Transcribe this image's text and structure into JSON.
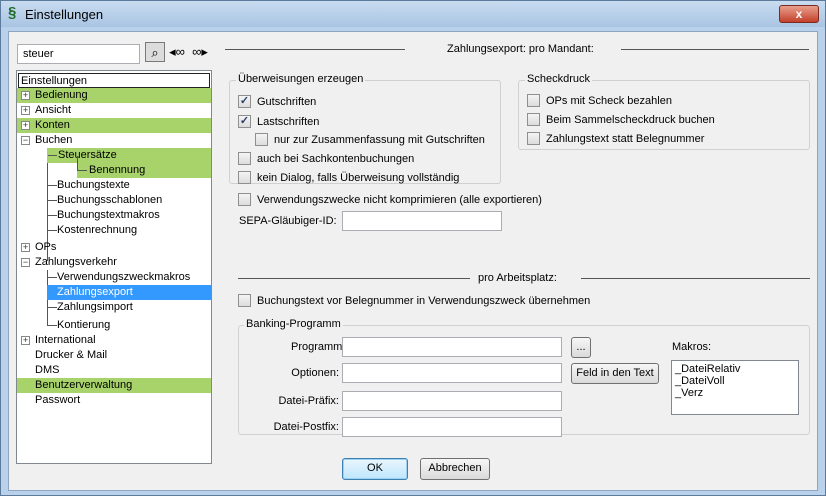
{
  "window": {
    "title": "Einstellungen",
    "close_label": "x"
  },
  "search": {
    "value": "steuer",
    "buttons": [
      "binoculars-icon",
      "find-prev-icon",
      "find-next-icon"
    ]
  },
  "tree": {
    "root": "Einstellungen",
    "items": {
      "bedienung": "Bedienung",
      "ansicht": "Ansicht",
      "konten": "Konten",
      "buchen": "Buchen",
      "steuersaetze": "Steuersätze",
      "benennung": "Benennung",
      "buchungstexte": "Buchungstexte",
      "buchungsschablonen": "Buchungsschablonen",
      "buchungstextmakros": "Buchungstextmakros",
      "kostenrechnung": "Kostenrechnung",
      "ops": "OPs",
      "zahlungsverkehr": "Zahlungsverkehr",
      "verwendungszweckmakros": "Verwendungszweckmakros",
      "zahlungsexport": "Zahlungsexport",
      "zahlungsimport": "Zahlungsimport",
      "kontierung": "Kontierung",
      "international": "International",
      "drucker": "Drucker & Mail",
      "dms": "DMS",
      "benutzerverwaltung": "Benutzerverwaltung",
      "passwort": "Passwort"
    },
    "expander_plus": "+",
    "expander_minus": "−"
  },
  "mandant": {
    "title": "Zahlungsexport: pro Mandant:",
    "ueberweisungen": {
      "label": "Überweisungen erzeugen",
      "gutschriften": {
        "label": "Gutschriften",
        "checked": true
      },
      "lastschriften": {
        "label": "Lastschriften",
        "checked": true
      },
      "nur_zusammenfassung": {
        "label": "nur zur Zusammenfassung mit Gutschriften",
        "checked": false
      },
      "sachkonten": {
        "label": "auch bei Sachkontenbuchungen",
        "checked": false
      },
      "kein_dialog": {
        "label": "kein Dialog, falls Überweisung vollständig",
        "checked": false
      }
    },
    "scheckdruck": {
      "label": "Scheckdruck",
      "ops_scheck": {
        "label": "OPs mit Scheck bezahlen",
        "checked": false
      },
      "sammel": {
        "label": "Beim Sammelscheckdruck buchen",
        "checked": false
      },
      "zahlungstext": {
        "label": "Zahlungstext statt Belegnummer",
        "checked": false
      }
    },
    "verwendungszwecke": {
      "label": "Verwendungszwecke nicht komprimieren (alle exportieren)",
      "checked": false
    },
    "sepa_label": "SEPA-Gläubiger-ID:",
    "sepa_value": ""
  },
  "arbeitsplatz": {
    "title": "pro Arbeitsplatz:",
    "buchungstext": {
      "label": "Buchungstext vor Belegnummer in Verwendungszweck übernehmen",
      "checked": false
    },
    "banking": {
      "label": "Banking-Programm",
      "programm_label": "Programm:",
      "programm_value": "",
      "optionen_label": "Optionen:",
      "optionen_value": "",
      "praefix_label": "Datei-Präfix:",
      "praefix_value": "",
      "postfix_label": "Datei-Postfix:",
      "postfix_value": "",
      "browse_label": "...",
      "feld_label": "Feld in den Text",
      "makros_label": "Makros:",
      "makros": [
        "_DateiRelativ",
        "_DateiVoll",
        "_Verz"
      ]
    }
  },
  "footer": {
    "ok_label": "OK",
    "cancel_label": "Abbrechen"
  },
  "check_glyph": "✓"
}
